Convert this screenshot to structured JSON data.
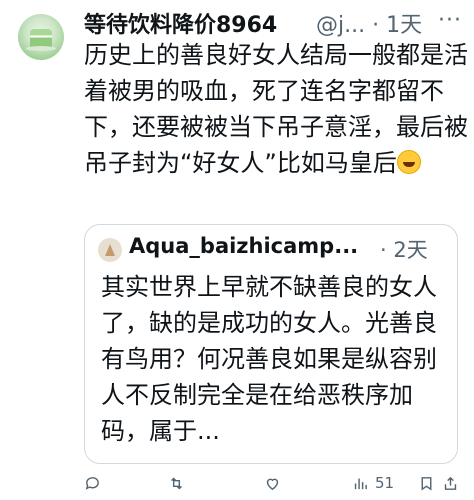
{
  "tweet": {
    "display_name": "等待饮料降价8964",
    "handle": "@j...",
    "separator": "·",
    "time": "1天",
    "more": "···",
    "text": "历史上的善良好女人结局一般都是活着被男的吸血，死了连名字都留不下，还要被被当下吊子意淫，最后被吊子封为“好女人”比如马皇后"
  },
  "quoted": {
    "display_name": "Aqua_baizhicamp...",
    "separator": "·",
    "time": "2天",
    "text": "其实世界上早就不缺善良的女人了，缺的是成功的女人。光善良有鸟用？何况善良如果是纵容别人不反制完全是在给恶秩序加码，属于..."
  },
  "actions": {
    "views": "51"
  },
  "icons": [
    "reply-icon",
    "retweet-icon",
    "like-icon",
    "views-icon",
    "bookmark-icon",
    "share-icon"
  ]
}
